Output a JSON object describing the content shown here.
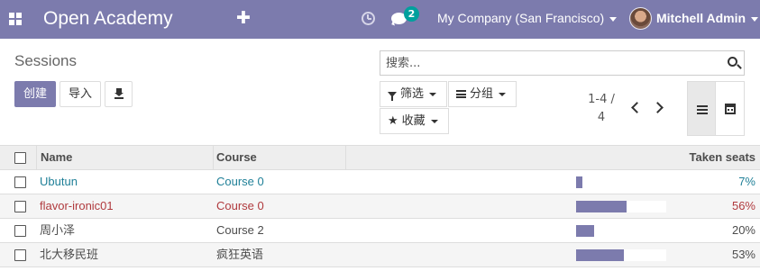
{
  "app": {
    "name": "Open Academy",
    "chat_count": "2",
    "company": "My Company (San Francisco)",
    "user": "Mitchell Admin"
  },
  "page": {
    "title": "Sessions",
    "create_label": "创建",
    "import_label": "导入",
    "search_placeholder": "搜索...",
    "filters_label": "筛选",
    "groupby_label": "分组",
    "favorites_label": "收藏",
    "pager_range": "1-4 /",
    "pager_total": "4"
  },
  "table": {
    "columns": {
      "name": "Name",
      "course": "Course",
      "taken_seats": "Taken seats"
    },
    "rows": [
      {
        "name": "Ubutun",
        "course": "Course 0",
        "taken_seats": "7%",
        "fill": 7,
        "color": "#1f8dae"
      },
      {
        "name": "flavor-ironic01",
        "course": "Course 0",
        "taken_seats": "56%",
        "fill": 56,
        "color": "#b03a3e"
      },
      {
        "name": "周小泽",
        "course": "Course 2",
        "taken_seats": "20%",
        "fill": 20,
        "color": "#4c4c4c"
      },
      {
        "name": "北大移民班",
        "course": "疯狂英语",
        "taken_seats": "53%",
        "fill": 53,
        "color": "#4c4c4c"
      }
    ]
  },
  "colors": {
    "brand": "#7c7bad",
    "badge": "#00a09d"
  }
}
